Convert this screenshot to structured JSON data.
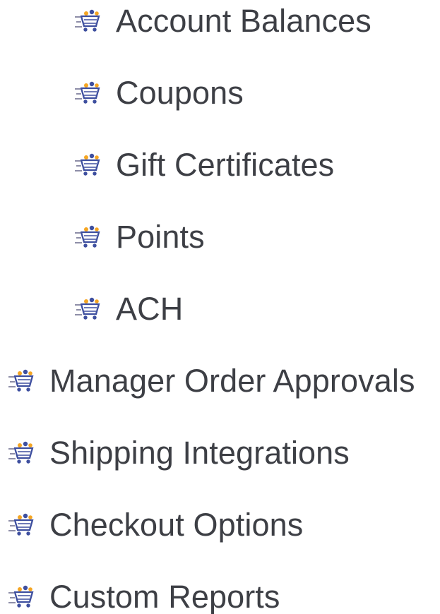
{
  "menu": {
    "sub_items": [
      {
        "label": "Account Balances",
        "icon": "cart-icon"
      },
      {
        "label": "Coupons",
        "icon": "cart-icon"
      },
      {
        "label": "Gift Certificates",
        "icon": "cart-icon"
      },
      {
        "label": "Points",
        "icon": "cart-icon"
      },
      {
        "label": "ACH",
        "icon": "cart-icon"
      }
    ],
    "top_items": [
      {
        "label": "Manager Order Approvals",
        "icon": "cart-icon"
      },
      {
        "label": "Shipping Integrations",
        "icon": "cart-icon"
      },
      {
        "label": "Checkout Options",
        "icon": "cart-icon"
      },
      {
        "label": "Custom Reports",
        "icon": "cart-icon"
      }
    ]
  },
  "colors": {
    "text": "#3d3f45",
    "cart_blue": "#3e4f9f",
    "cart_orange": "#f5a623",
    "cart_speed_lines": "#8e8ea8"
  }
}
